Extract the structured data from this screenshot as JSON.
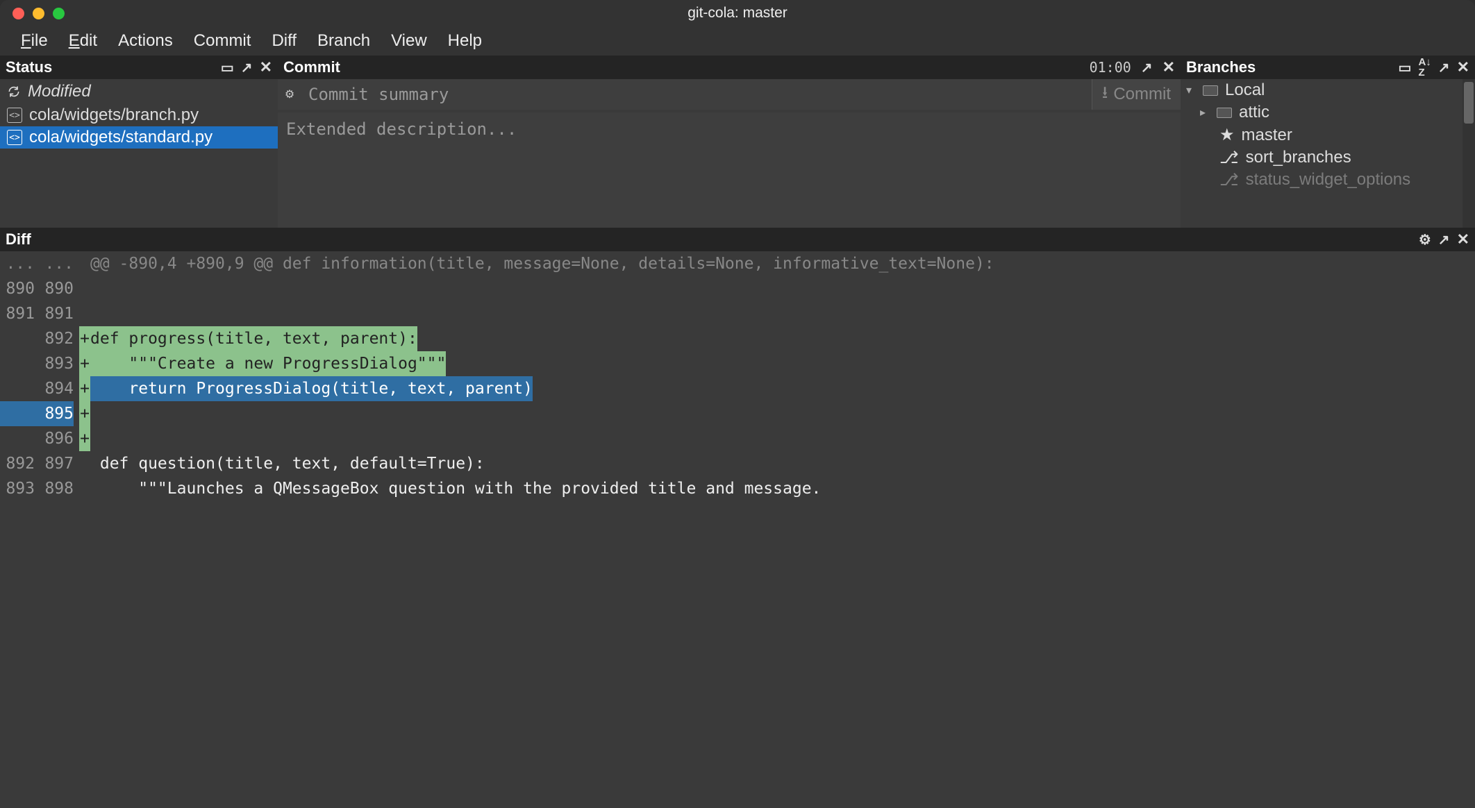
{
  "window": {
    "title": "git-cola: master"
  },
  "menubar": [
    "File",
    "Edit",
    "Actions",
    "Commit",
    "Diff",
    "Branch",
    "View",
    "Help"
  ],
  "status": {
    "title": "Status",
    "heading": "Modified",
    "files": [
      {
        "path": "cola/widgets/branch.py",
        "selected": false
      },
      {
        "path": "cola/widgets/standard.py",
        "selected": true
      }
    ]
  },
  "commit": {
    "title": "Commit",
    "time": "01:00",
    "summary_placeholder": "Commit summary",
    "desc_placeholder": "Extended description...",
    "button_label": "Commit"
  },
  "branches": {
    "title": "Branches",
    "local_label": "Local",
    "items": [
      {
        "icon": "folder",
        "label": "attic"
      },
      {
        "icon": "star",
        "label": "master"
      },
      {
        "icon": "branch",
        "label": "sort_branches"
      },
      {
        "icon": "branch",
        "label": "status_widget_options"
      }
    ]
  },
  "diff": {
    "title": "Diff",
    "lines": [
      {
        "a": "...",
        "b": "...",
        "m": " ",
        "t": "@@ -890,4 +890,9 @@ def information(title, message=None, details=None, informative_text=None):",
        "kind": "hunk"
      },
      {
        "a": "890",
        "b": "890",
        "m": " ",
        "t": "",
        "kind": "ctx"
      },
      {
        "a": "891",
        "b": "891",
        "m": " ",
        "t": "",
        "kind": "ctx"
      },
      {
        "a": "",
        "b": "892",
        "m": "+",
        "t": "def progress(title, text, parent):",
        "kind": "add-hl"
      },
      {
        "a": "",
        "b": "893",
        "m": "+",
        "t": "    \"\"\"Create a new ProgressDialog\"\"\"",
        "kind": "add-hl"
      },
      {
        "a": "",
        "b": "894",
        "m": "+",
        "t": "    return ProgressDialog(title, text, parent)",
        "kind": "add-sel"
      },
      {
        "a": "",
        "b": "895",
        "m": "+",
        "t": "",
        "kind": "add-sel-ln"
      },
      {
        "a": "",
        "b": "896",
        "m": "+",
        "t": "",
        "kind": "add-marker"
      },
      {
        "a": "892",
        "b": "897",
        "m": " ",
        "t": " def question(title, text, default=True):",
        "kind": "ctx"
      },
      {
        "a": "893",
        "b": "898",
        "m": " ",
        "t": "     \"\"\"Launches a QMessageBox question with the provided title and message.",
        "kind": "ctx"
      }
    ]
  }
}
